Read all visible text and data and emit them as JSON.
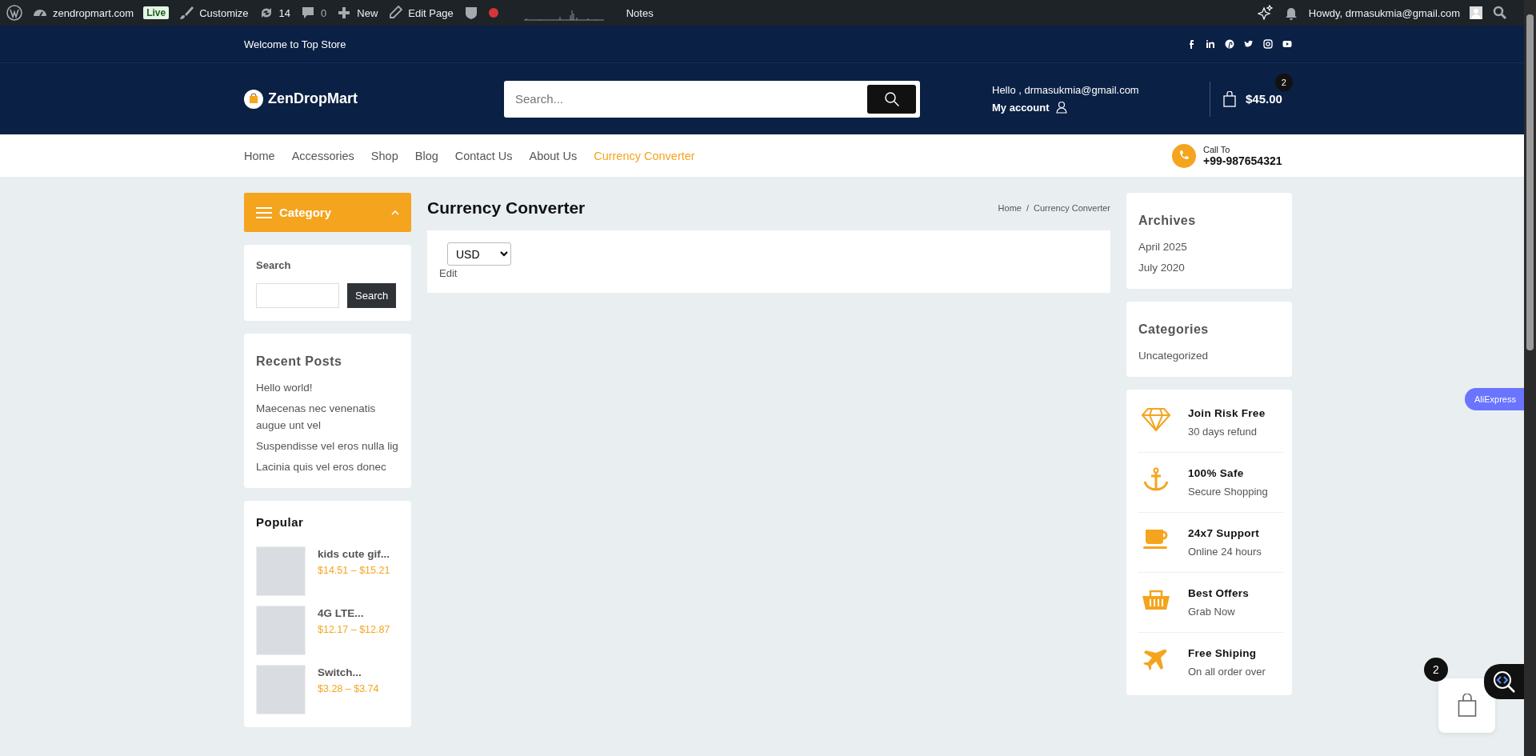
{
  "admin_bar": {
    "site": "zendropmart.com",
    "live_badge": "Live",
    "customize": "Customize",
    "updates": "14",
    "comments": "0",
    "new": "New",
    "edit_page": "Edit Page",
    "notes": "Notes",
    "howdy": "Howdy, drmasukmia@gmail.com"
  },
  "top_bar": {
    "welcome": "Welcome to Top Store"
  },
  "header": {
    "logo": "ZenDropMart",
    "search": {
      "placeholder": "Search..."
    },
    "hello": "Hello , drmasukmia@gmail.com",
    "my_account": "My account",
    "cart_total": "$45.00",
    "cart_count": "2"
  },
  "nav": {
    "items": [
      {
        "label": "Home",
        "selected": false
      },
      {
        "label": "Accessories",
        "selected": false
      },
      {
        "label": "Shop",
        "selected": false
      },
      {
        "label": "Blog",
        "selected": false
      },
      {
        "label": "Contact Us",
        "selected": false
      },
      {
        "label": "About Us",
        "selected": false
      },
      {
        "label": "Currency Converter",
        "selected": true
      }
    ],
    "call_label": "Call To",
    "phone": "+99-987654321"
  },
  "category_button": {
    "label": "Category",
    "expanded": true
  },
  "search_widget": {
    "title": "Search",
    "button": "Search"
  },
  "recent_posts": {
    "title": "Recent Posts",
    "items": [
      "Hello world!",
      "Maecenas nec venenatis augue unt vel",
      "Suspendisse vel eros nulla lig",
      "Lacinia quis vel eros donec"
    ]
  },
  "popular": {
    "title": "Popular",
    "items": [
      {
        "name": "kids cute gif...",
        "price": "$14.51 – $15.21"
      },
      {
        "name": "4G LTE...",
        "price": "$12.17 – $12.87"
      },
      {
        "name": "Switch...",
        "price": "$3.28 – $3.74"
      }
    ]
  },
  "page": {
    "title": "Currency Converter",
    "breadcrumb": [
      "Home",
      "Currency Converter"
    ],
    "breadcrumb_separator": "/",
    "currency_select": "USD",
    "edit_link": "Edit"
  },
  "archives": {
    "title": "Archives",
    "items": [
      "April 2025",
      "July 2020"
    ]
  },
  "categories": {
    "title": "Categories",
    "items": [
      "Uncategorized"
    ]
  },
  "features": [
    {
      "kind": "diamond",
      "title": "Join Risk Free",
      "subtitle": "30 days refund"
    },
    {
      "kind": "anchor",
      "title": "100% Safe",
      "subtitle": "Secure Shopping"
    },
    {
      "kind": "cup",
      "title": "24x7 Support",
      "subtitle": "Online 24 hours"
    },
    {
      "kind": "basket",
      "title": "Best Offers",
      "subtitle": "Grab Now"
    },
    {
      "kind": "plane",
      "title": "Free Shiping",
      "subtitle": "On all order over"
    }
  ],
  "floating": {
    "aliexpress": "AliExpress",
    "cart_count": "2"
  }
}
